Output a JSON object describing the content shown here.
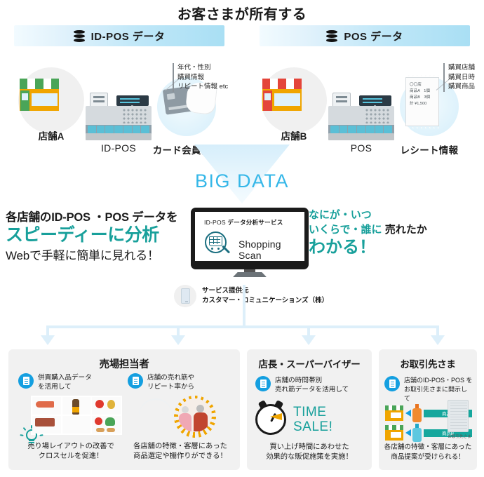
{
  "title": "お客さまが所有する",
  "banners": [
    {
      "label": "ID-POS データ",
      "icon": "database-icon"
    },
    {
      "label": "POS データ",
      "icon": "database-icon"
    }
  ],
  "sources": [
    {
      "store_label": "店舗A",
      "system_label": "ID-POS",
      "info_label": "カード会員情報",
      "info_type": "card",
      "annotations": [
        "年代・性別",
        "購買情報",
        "リピート情報 etc"
      ]
    },
    {
      "store_label": "店舗B",
      "system_label": "POS",
      "info_label": "レシート情報",
      "info_type": "receipt",
      "annotations": [
        "購買店舗",
        "購買日時",
        "購買商品"
      ],
      "receipt_lines": [
        "〇〇店",
        "商品A　1個",
        "商品B　3個",
        "計 ¥1,500"
      ]
    }
  ],
  "bigdata_label": "BIG DATA",
  "monitor": {
    "service_title_plain": "ID-POS ",
    "service_title_bold": "データ分析サービス",
    "brand": "Shopping Scan",
    "icon": "magnifier-cart-icon"
  },
  "copy_left": {
    "line1": "各店舗のID-POS ・POS データを",
    "line2": "スピーディーに分析",
    "line3": "Webで手軽に簡単に見れる！"
  },
  "copy_right": {
    "line1": "なにが・いつ",
    "line2_teal": "いくらで・誰に ",
    "line2_black": "売れたか",
    "line3": "わかる！"
  },
  "provider": {
    "label": "サービス提供元",
    "company": "カスタマー・コミュニケーションズ（株）"
  },
  "panels": [
    {
      "title": "売場担当者",
      "items": [
        {
          "lead_line1": "併買購入品データ",
          "lead_line2": "を活用して",
          "caption_line1": "売り場レイアウトの改善で",
          "caption_line2": "クロスセルを促進！"
        },
        {
          "lead_line1": "店舗の売れ筋や",
          "lead_line2": "リピート率から",
          "caption_line1": "各店舗の特徴・客層にあった",
          "caption_line2": "商品選定や棚作りができる！"
        }
      ]
    },
    {
      "title": "店長・スーパーバイザー",
      "items": [
        {
          "lead_line1": "店舗の時間帯別",
          "lead_line2": "売れ筋データを活用して",
          "badge_line1": "TIME",
          "badge_line2": "SALE!",
          "caption_line1": "買い上げ時間にあわせた",
          "caption_line2": "効果的な販促施策を実施！"
        }
      ]
    },
    {
      "title": "お取引先さま",
      "items": [
        {
          "lead_line1": "店舗のID-POS・POS を",
          "lead_line2": "お取引先さまに開示して",
          "flow": [
            "商品A",
            "商品B"
          ],
          "partner_label": "お取引先さま",
          "caption_line1": "各店舗の特徴・客層にあった",
          "caption_line2": "商品提案が受けられる！"
        }
      ]
    }
  ],
  "colors": {
    "accent_cyan": "#35b7e8",
    "accent_teal": "#18a09b",
    "icon_blue": "#149fe0",
    "connector": "#ddeffa",
    "panel_bg": "#f1f1f1"
  }
}
